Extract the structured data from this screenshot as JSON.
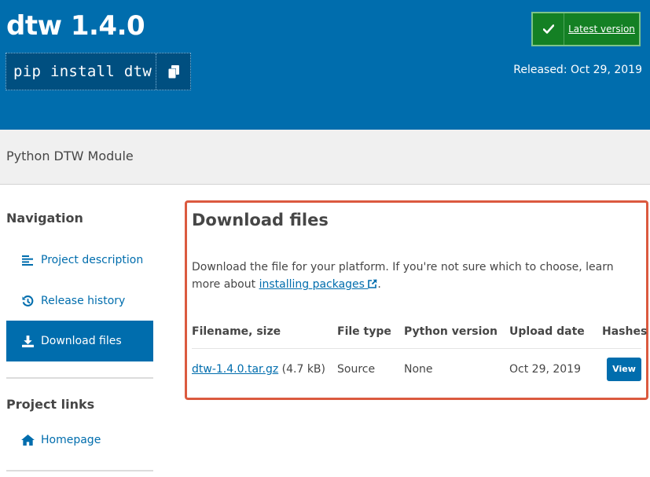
{
  "header": {
    "title": "dtw 1.4.0",
    "pip_command": "pip install dtw",
    "copy_icon": "copy-icon",
    "latest_badge": {
      "icon": "check-icon",
      "label": "Latest version"
    },
    "released": "Released: Oct 29, 2019"
  },
  "summary": {
    "text": "Python DTW Module"
  },
  "sidebar": {
    "navigation_heading": "Navigation",
    "items": [
      {
        "label": "Project description",
        "icon": "list-icon",
        "active": false
      },
      {
        "label": "Release history",
        "icon": "history-icon",
        "active": false
      },
      {
        "label": "Download files",
        "icon": "download-icon",
        "active": true
      }
    ],
    "links_heading": "Project links",
    "links": [
      {
        "label": "Homepage",
        "icon": "home-icon"
      }
    ]
  },
  "main": {
    "title": "Download files",
    "description_prefix": "Download the file for your platform. If you're not sure which to choose, learn more about ",
    "description_link": "installing packages",
    "description_suffix": ".",
    "table": {
      "headers": [
        "Filename, size",
        "File type",
        "Python version",
        "Upload date",
        "Hashes"
      ],
      "rows": [
        {
          "filename": "dtw-1.4.0.tar.gz",
          "size": "(4.7 kB)",
          "file_type": "Source",
          "python_version": "None",
          "upload_date": "Oct 29, 2019",
          "hashes_button": "View"
        }
      ]
    }
  },
  "colors": {
    "brand_blue": "#006dad",
    "latest_green": "#148024",
    "highlight_red": "#db5a3f"
  }
}
